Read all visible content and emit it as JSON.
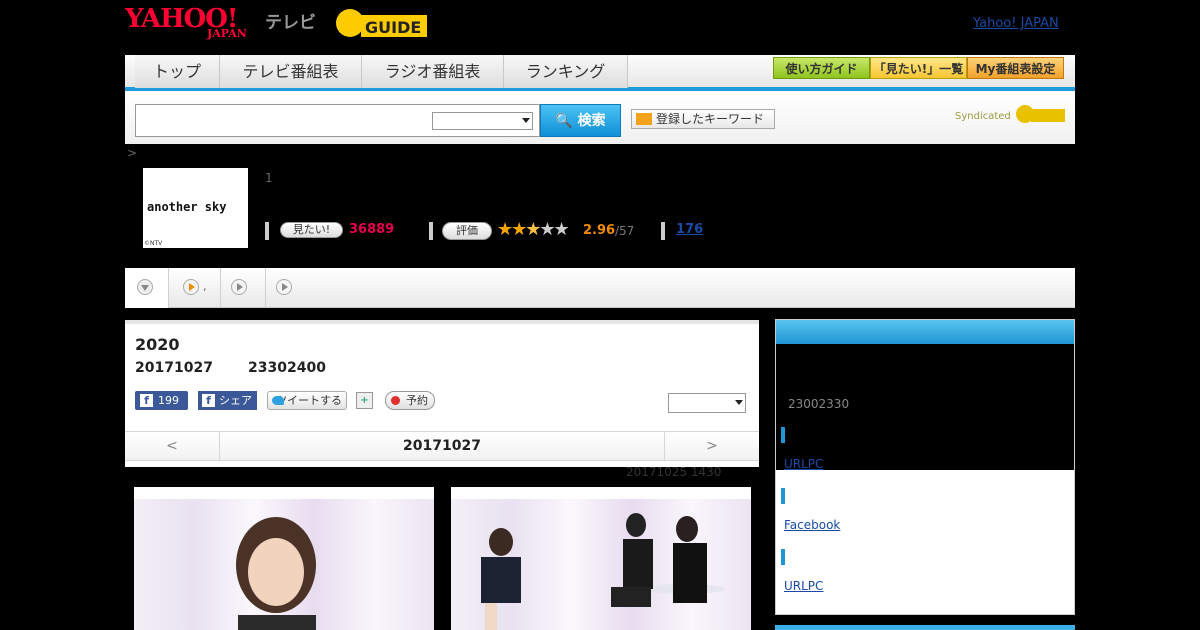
{
  "header": {
    "logo_text": "YAHOO!",
    "logo_sub": "JAPAN",
    "tv_label": "テレビ",
    "gguide_text": "GUIDE",
    "yahoo_japan_link": "Yahoo! JAPAN"
  },
  "nav": {
    "tabs": [
      "トップ",
      "テレビ番組表",
      "ラジオ番組表",
      "ランキング"
    ],
    "buttons": [
      "使い方ガイド",
      "「見たい!」一覧",
      "My番組表設定"
    ],
    "search_button": "検索",
    "keyword_button": "登録したキーワード",
    "syndicated": "Syndicated"
  },
  "breadcrumb": ">",
  "program": {
    "thumb_title": "another sky",
    "thumb_copyright": "©NTV",
    "number": "1",
    "want_label": "見たい!",
    "want_count": "36889",
    "rate_label": "評価",
    "rating": "2.96",
    "rating_count": "/57",
    "comments": "176"
  },
  "episode": {
    "title": "2020",
    "date": "20171027",
    "id": "23302400",
    "fb_like_count": "199",
    "fb_share": "シェア",
    "tweet": "ツイートする",
    "reserve": "予約",
    "prev": "<",
    "nav_date": "20171027",
    "next": ">",
    "updated": "20171025  1430"
  },
  "sidebar": {
    "time": "23002330",
    "links": [
      "URLPC",
      "Facebook",
      "URLPC"
    ]
  },
  "colors": {
    "accent_blue": "#1e96d3",
    "yahoo_red": "#ff0033",
    "want_pink": "#e6004c",
    "rating_orange": "#f08a00"
  }
}
